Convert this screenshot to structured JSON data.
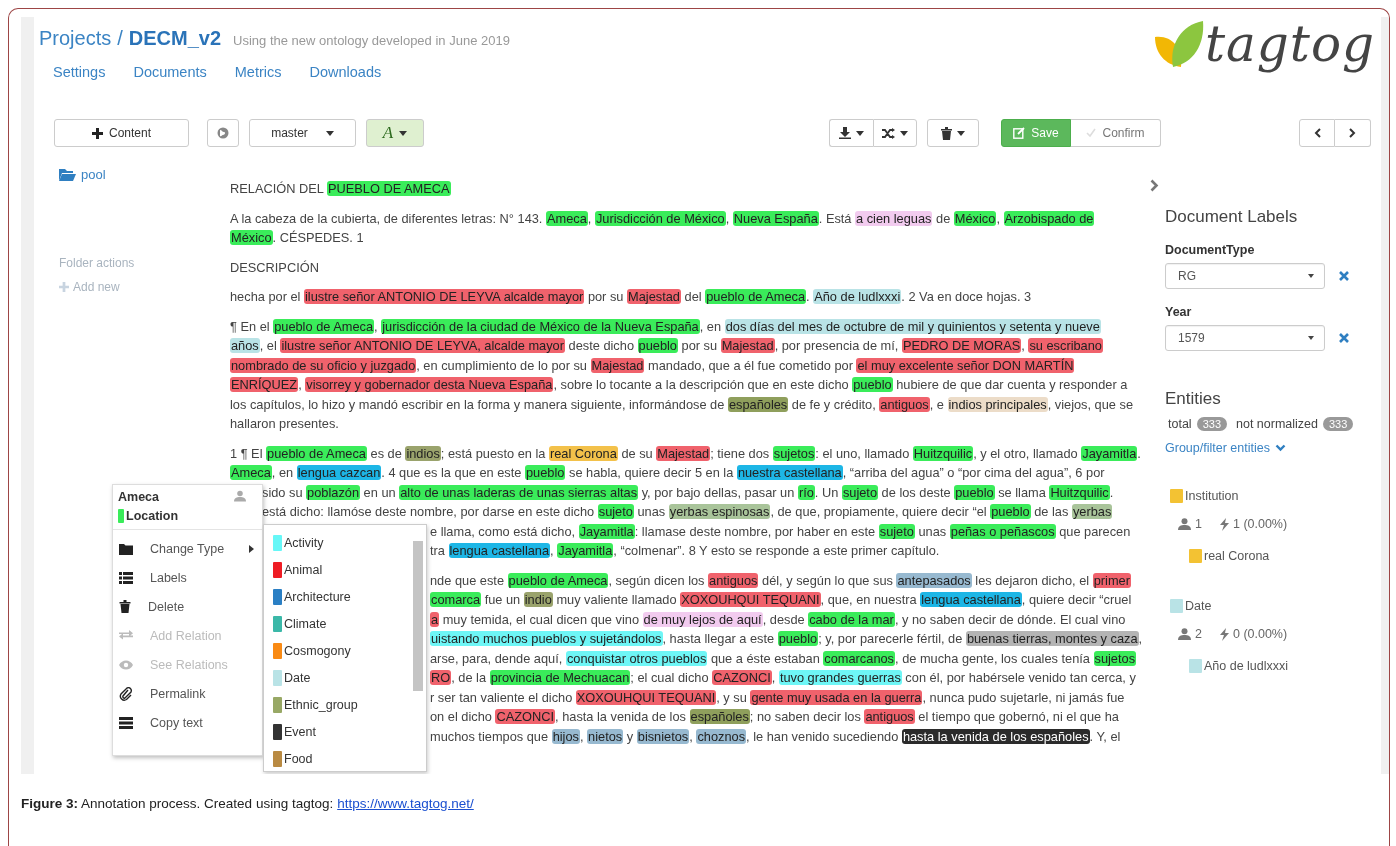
{
  "header": {
    "crumb": "Projects",
    "separator": "/",
    "project": "DECM_v2",
    "description": "Using the new ontology developed in June 2019"
  },
  "nav": [
    {
      "label": "Settings"
    },
    {
      "label": "Documents"
    },
    {
      "label": "Metrics"
    },
    {
      "label": "Downloads"
    }
  ],
  "logo": {
    "text": "tagtog"
  },
  "toolbar": {
    "content_button": "Content",
    "branch": "master",
    "annotate": "A",
    "save": "Save",
    "confirm": {
      "label": "Confirm",
      "disabled": true
    }
  },
  "sidebar": {
    "folder": "pool",
    "folder_actions": "Folder actions",
    "add_new": "Add new"
  },
  "document": {
    "paragraphs": [
      {
        "lines": [
          {
            "segments": [
              {
                "text": "RELACIÓN DEL "
              },
              {
                "text": "PUEBLO DE AMECA",
                "color": "#3aec5a"
              }
            ]
          }
        ]
      },
      {
        "lines": [
          {
            "segments": [
              {
                "text": "A la cabeza de la cubierta, de diferentes letras: N° 143. "
              },
              {
                "text": "Ameca",
                "color": "#3aec5a"
              },
              {
                "text": ", "
              },
              {
                "text": "Jurisdicción de México",
                "color": "#3aec5a"
              },
              {
                "text": ", "
              },
              {
                "text": "Nueva España",
                "color": "#3aec5a"
              },
              {
                "text": ". Está "
              },
              {
                "text": "a cien leguas",
                "color": "#f2cbef"
              },
              {
                "text": " de "
              },
              {
                "text": "México",
                "color": "#3aec5a"
              },
              {
                "text": ", "
              },
              {
                "text": "Arzobispado de",
                "color": "#3aec5a"
              }
            ]
          },
          {
            "segments": [
              {
                "text": "México",
                "color": "#3aec5a"
              },
              {
                "text": ". CÉSPEDES. 1"
              }
            ]
          }
        ]
      },
      {
        "lines": [
          {
            "segments": [
              {
                "text": "DESCRIPCIÓN"
              }
            ]
          }
        ]
      },
      {
        "lines": [
          {
            "segments": [
              {
                "text": "hecha por el "
              },
              {
                "text": "ilustre señor ANTONIO DE LEYVA alcalde mayor",
                "color": "#f0626c"
              },
              {
                "text": " por su "
              },
              {
                "text": "Majestad",
                "color": "#f0626c"
              },
              {
                "text": " del "
              },
              {
                "text": "pueblo de Ameca",
                "color": "#3aec5a"
              },
              {
                "text": ". "
              },
              {
                "text": "Año de ludlxxxi",
                "color": "#b9e3e6"
              },
              {
                "text": ". 2 Va en doce hojas. 3"
              }
            ]
          }
        ]
      },
      {
        "lines": [
          {
            "segments": [
              {
                "text": "¶ En el "
              },
              {
                "text": "pueblo de Ameca",
                "color": "#3aec5a"
              },
              {
                "text": ", "
              },
              {
                "text": "jurisdicción de la ciudad de México de la Nueva España",
                "color": "#3aec5a"
              },
              {
                "text": ", en "
              },
              {
                "text": "dos días del mes de octubre de mil y quinientos y setenta y nueve",
                "color": "#b9e3e6"
              }
            ]
          },
          {
            "segments": [
              {
                "text": "años",
                "color": "#b9e3e6"
              },
              {
                "text": ", el "
              },
              {
                "text": "ilustre señor ANTONIO DE LEYVA, alcalde mayor",
                "color": "#f0626c"
              },
              {
                "text": " deste dicho "
              },
              {
                "text": "pueblo",
                "color": "#3aec5a"
              },
              {
                "text": " por su "
              },
              {
                "text": "Majestad",
                "color": "#f0626c"
              },
              {
                "text": ", por presencia de mí, "
              },
              {
                "text": "PEDRO DE MORAS",
                "color": "#f0626c"
              },
              {
                "text": ", "
              },
              {
                "text": "su escribano",
                "color": "#f0626c"
              }
            ]
          },
          {
            "segments": [
              {
                "text": "nombrado de su oficio y juzgado",
                "color": "#f0626c"
              },
              {
                "text": ", en cumplimiento de lo por su "
              },
              {
                "text": "Majestad",
                "color": "#f0626c"
              },
              {
                "text": " mandado, que a él fue cometido por "
              },
              {
                "text": "el muy excelente señor DON MARTÍN",
                "color": "#f0626c"
              }
            ]
          },
          {
            "segments": [
              {
                "text": "ENRÍQUEZ",
                "color": "#f0626c"
              },
              {
                "text": ", "
              },
              {
                "text": "visorrey y gobernador desta Nueva España",
                "color": "#f0626c"
              },
              {
                "text": ", sobre lo tocante a la descripción que en este dicho "
              },
              {
                "text": "pueblo",
                "color": "#3aec5a"
              },
              {
                "text": " hubiere de que dar cuenta y responder a"
              }
            ]
          },
          {
            "segments": [
              {
                "text": "los capítulos, lo hizo y mandó escribir en la forma y manera siguiente, informándose de "
              },
              {
                "text": "españoles",
                "color": "#8f9f5c"
              },
              {
                "text": " de fe y crédito, "
              },
              {
                "text": "antiguos",
                "color": "#f0626c"
              },
              {
                "text": ", e "
              },
              {
                "text": "indios principales",
                "color": "#ecdcc8"
              },
              {
                "text": ", viejos, que se"
              }
            ]
          },
          {
            "segments": [
              {
                "text": "hallaron presentes."
              }
            ]
          }
        ]
      },
      {
        "lines": [
          {
            "segments": [
              {
                "text": "1 ¶ El "
              },
              {
                "text": "pueblo de Ameca",
                "color": "#3aec5a"
              },
              {
                "text": " es de "
              },
              {
                "text": "indios",
                "color": "#9aa36c"
              },
              {
                "text": "; está puesto en la "
              },
              {
                "text": "real Corona",
                "color": "#f3c14a"
              },
              {
                "text": " de su "
              },
              {
                "text": "Majestad",
                "color": "#f0626c"
              },
              {
                "text": "; tiene dos "
              },
              {
                "text": "sujetos",
                "color": "#3aec5a"
              },
              {
                "text": ": el uno, llamado "
              },
              {
                "text": "Huitzquilic",
                "color": "#3aec5a"
              },
              {
                "text": ", y el otro, llamado "
              },
              {
                "text": "Jayamitla",
                "color": "#3aec5a"
              },
              {
                "text": "."
              }
            ]
          },
          {
            "segments": [
              {
                "text": "Ameca",
                "color": "#3aec5a"
              },
              {
                "text": ", en "
              },
              {
                "text": "lengua cazcan",
                "color": "#1db6e6"
              },
              {
                "text": ". 4 que es la que en este "
              },
              {
                "text": "pueblo",
                "color": "#3aec5a"
              },
              {
                "text": " se habla, quiere decir 5 en la "
              },
              {
                "text": "nuestra castellana",
                "color": "#1db6e6"
              },
              {
                "text": ", “arriba del agua” o “por cima del agua”, 6 por"
              }
            ]
          },
          {
            "under_menu": true,
            "segments": [
              {
                "text": "sido su "
              },
              {
                "text": "poblazón",
                "color": "#3aec5a"
              },
              {
                "text": " en un "
              },
              {
                "text": "alto de unas laderas de unas sierras altas",
                "color": "#3aec5a"
              },
              {
                "text": " y, por bajo dellas, pasar un "
              },
              {
                "text": "río",
                "color": "#3aec5a"
              },
              {
                "text": ". Un "
              },
              {
                "text": "sujeto",
                "color": "#3aec5a"
              },
              {
                "text": " de los deste "
              },
              {
                "text": "pueblo",
                "color": "#3aec5a"
              },
              {
                "text": " se llama "
              },
              {
                "text": "Huitzquilic",
                "color": "#3aec5a"
              },
              {
                "text": "."
              }
            ]
          },
          {
            "under_menu": true,
            "segments": [
              {
                "text": "está dicho: llamóse deste nombre, por darse en este dicho "
              },
              {
                "text": "sujeto",
                "color": "#3aec5a"
              },
              {
                "text": " unas "
              },
              {
                "text": "yerbas espinosas",
                "color": "#a9c49a"
              },
              {
                "text": ", de que, propiamente, quiere decir “el "
              },
              {
                "text": "pueblo",
                "color": "#3aec5a"
              },
              {
                "text": " de las "
              },
              {
                "text": "yerbas",
                "color": "#a9c49a"
              }
            ]
          },
          {
            "under_submenu": true,
            "segments": [
              {
                "text": "e llama, como está dicho, "
              },
              {
                "text": "Jayamitla",
                "color": "#3aec5a"
              },
              {
                "text": ": llamase deste nombre, por haber en este "
              },
              {
                "text": "sujeto",
                "color": "#3aec5a"
              },
              {
                "text": " unas "
              },
              {
                "text": "peñas o peñascos",
                "color": "#3aec5a"
              },
              {
                "text": " que parecen"
              }
            ]
          },
          {
            "under_submenu": true,
            "segments": [
              {
                "text": "tra "
              },
              {
                "text": "lengua castellana",
                "color": "#1db6e6"
              },
              {
                "text": ", "
              },
              {
                "text": "Jayamitla",
                "color": "#3aec5a"
              },
              {
                "text": ", “colmenar”. 8 Y esto se responde a este primer capítulo."
              }
            ]
          }
        ]
      },
      {
        "lines": [
          {
            "under_submenu": true,
            "segments": [
              {
                "text": "nde que este "
              },
              {
                "text": "pueblo de Ameca",
                "color": "#3aec5a"
              },
              {
                "text": ", según dicen los "
              },
              {
                "text": "antiguos",
                "color": "#f0626c"
              },
              {
                "text": " dél, y según lo que sus "
              },
              {
                "text": "antepasados",
                "color": "#97b9d0"
              },
              {
                "text": " les dejaron dicho, el "
              },
              {
                "text": "primer",
                "color": "#f0626c"
              }
            ]
          },
          {
            "under_submenu": true,
            "segments": [
              {
                "text": "comarca",
                "color": "#3aec5a"
              },
              {
                "text": " fue un "
              },
              {
                "text": "indio",
                "color": "#9aa36c"
              },
              {
                "text": " muy valiente llamado "
              },
              {
                "text": "XOXOUHQUI TEQUANI",
                "color": "#f0626c"
              },
              {
                "text": ", que, en nuestra "
              },
              {
                "text": "lengua castellana",
                "color": "#1db6e6"
              },
              {
                "text": ", quiere decir “cruel"
              }
            ]
          },
          {
            "under_submenu": true,
            "segments": [
              {
                "text": "a",
                "color": "#f0626c"
              },
              {
                "text": " muy temida, el cual dicen que vino "
              },
              {
                "text": "de muy lejos de aquí",
                "color": "#f2cbef"
              },
              {
                "text": ", desde "
              },
              {
                "text": "cabo de la mar",
                "color": "#3aec5a"
              },
              {
                "text": ", y no saben decir de dónde. El cual vino"
              }
            ]
          },
          {
            "under_submenu": true,
            "segments": [
              {
                "text": "uistando muchos pueblos y sujetándolos",
                "color": "#6ef6f6"
              },
              {
                "text": ", hasta llegar a este "
              },
              {
                "text": "pueblo",
                "color": "#3aec5a"
              },
              {
                "text": "; y, por parecerle fértil, de "
              },
              {
                "text": "buenas tierras, montes y caza",
                "color": "#b4b4b4"
              },
              {
                "text": ","
              }
            ]
          },
          {
            "under_submenu": true,
            "segments": [
              {
                "text": "arse, para, dende aquí, "
              },
              {
                "text": "conquistar otros pueblos",
                "color": "#6ef6f6"
              },
              {
                "text": " que a éste estaban "
              },
              {
                "text": "comarcanos",
                "color": "#3aec5a"
              },
              {
                "text": ", de mucha gente, los cuales tenía "
              },
              {
                "text": "sujetos",
                "color": "#3aec5a"
              }
            ]
          },
          {
            "under_submenu": true,
            "segments": [
              {
                "text": "RO",
                "color": "#f0626c"
              },
              {
                "text": ", de la "
              },
              {
                "text": "provincia de Mechuacan",
                "color": "#3aec5a"
              },
              {
                "text": "; el cual dicho "
              },
              {
                "text": "CAZONCI",
                "color": "#f0626c"
              },
              {
                "text": ", "
              },
              {
                "text": "tuvo grandes guerras",
                "color": "#6ef6f6"
              },
              {
                "text": " con él, por habérsele venido tan cerca, y"
              }
            ]
          },
          {
            "under_submenu": true,
            "segments": [
              {
                "text": "r ser tan valiente el dicho "
              },
              {
                "text": "XOXOUHQUI TEQUANI",
                "color": "#f0626c"
              },
              {
                "text": ", y su "
              },
              {
                "text": "gente muy usada en la guerra",
                "color": "#f0626c"
              },
              {
                "text": ", nunca pudo sujetarle, ni jamás fue"
              }
            ]
          },
          {
            "under_submenu": true,
            "segments": [
              {
                "text": "on el dicho "
              },
              {
                "text": "CAZONCI",
                "color": "#f0626c"
              },
              {
                "text": ", hasta la venida de los "
              },
              {
                "text": "españoles",
                "color": "#8f9f5c"
              },
              {
                "text": "; no saben decir los "
              },
              {
                "text": "antiguos",
                "color": "#f0626c"
              },
              {
                "text": " el tiempo que gobernó, ni el que ha"
              }
            ]
          },
          {
            "under_submenu": true,
            "segments": [
              {
                "text": "muchos tiempos que "
              },
              {
                "text": "hijos",
                "color": "#97b9d0"
              },
              {
                "text": ", "
              },
              {
                "text": "nietos",
                "color": "#97b9d0"
              },
              {
                "text": " y "
              },
              {
                "text": "bisnietos",
                "color": "#97b9d0"
              },
              {
                "text": ", "
              },
              {
                "text": "choznos",
                "color": "#97b9d0"
              },
              {
                "text": ", le han venido sucediendo "
              },
              {
                "text": "hasta la venida de los españoles",
                "color": "#2b2b2b"
              },
              {
                "text": ". Y, el"
              }
            ]
          }
        ]
      }
    ]
  },
  "context_menu": {
    "title": "Ameca",
    "type": {
      "label": "Location",
      "color": "#3aec5a"
    },
    "items": [
      {
        "label": "Change Type",
        "disabled": false,
        "submenu": true
      },
      {
        "label": "Labels",
        "disabled": false,
        "submenu": false
      },
      {
        "label": "Delete",
        "disabled": false,
        "submenu": false
      },
      {
        "label": "Add Relation",
        "disabled": true,
        "submenu": false
      },
      {
        "label": "See Relations",
        "disabled": true,
        "submenu": false
      },
      {
        "label": "Permalink",
        "disabled": false,
        "submenu": false
      },
      {
        "label": "Copy text",
        "disabled": false,
        "submenu": false
      }
    ],
    "types": [
      {
        "label": "Activity",
        "color": "#66f7f7"
      },
      {
        "label": "Animal",
        "color": "#ee1c24"
      },
      {
        "label": "Architecture",
        "color": "#2a7fc4"
      },
      {
        "label": "Climate",
        "color": "#3bb8a8"
      },
      {
        "label": "Cosmogony",
        "color": "#f98a14"
      },
      {
        "label": "Date",
        "color": "#b9e3e6"
      },
      {
        "label": "Ethnic_group",
        "color": "#98a865"
      },
      {
        "label": "Event",
        "color": "#333333"
      },
      {
        "label": "Food",
        "color": "#b98a42"
      }
    ]
  },
  "right_panel": {
    "document_labels": {
      "title": "Document Labels",
      "fields": [
        {
          "label": "DocumentType",
          "value": "RG"
        },
        {
          "label": "Year",
          "value": "1579"
        }
      ]
    },
    "entities": {
      "title": "Entities",
      "total_label": "total",
      "total": "333",
      "not_normalized_label": "not normalized",
      "not_normalized": "333",
      "group_filter": "Group/filter entities",
      "groups": [
        {
          "name": "Institution",
          "color": "#f3c233",
          "users": "1",
          "count": "1 (0.00%)",
          "entities": [
            {
              "text": "real Corona",
              "color": "#f3c233"
            }
          ]
        },
        {
          "name": "Date",
          "color": "#b9e3e6",
          "users": "2",
          "count": "0 (0.00%)",
          "entities": [
            {
              "text": "Año de ludlxxxi",
              "color": "#b9e3e6"
            }
          ]
        }
      ]
    }
  },
  "caption": {
    "text": "**Figure 3:** Annotation process. Created using tagtog:",
    "link": "https://www.tagtog.net/"
  }
}
